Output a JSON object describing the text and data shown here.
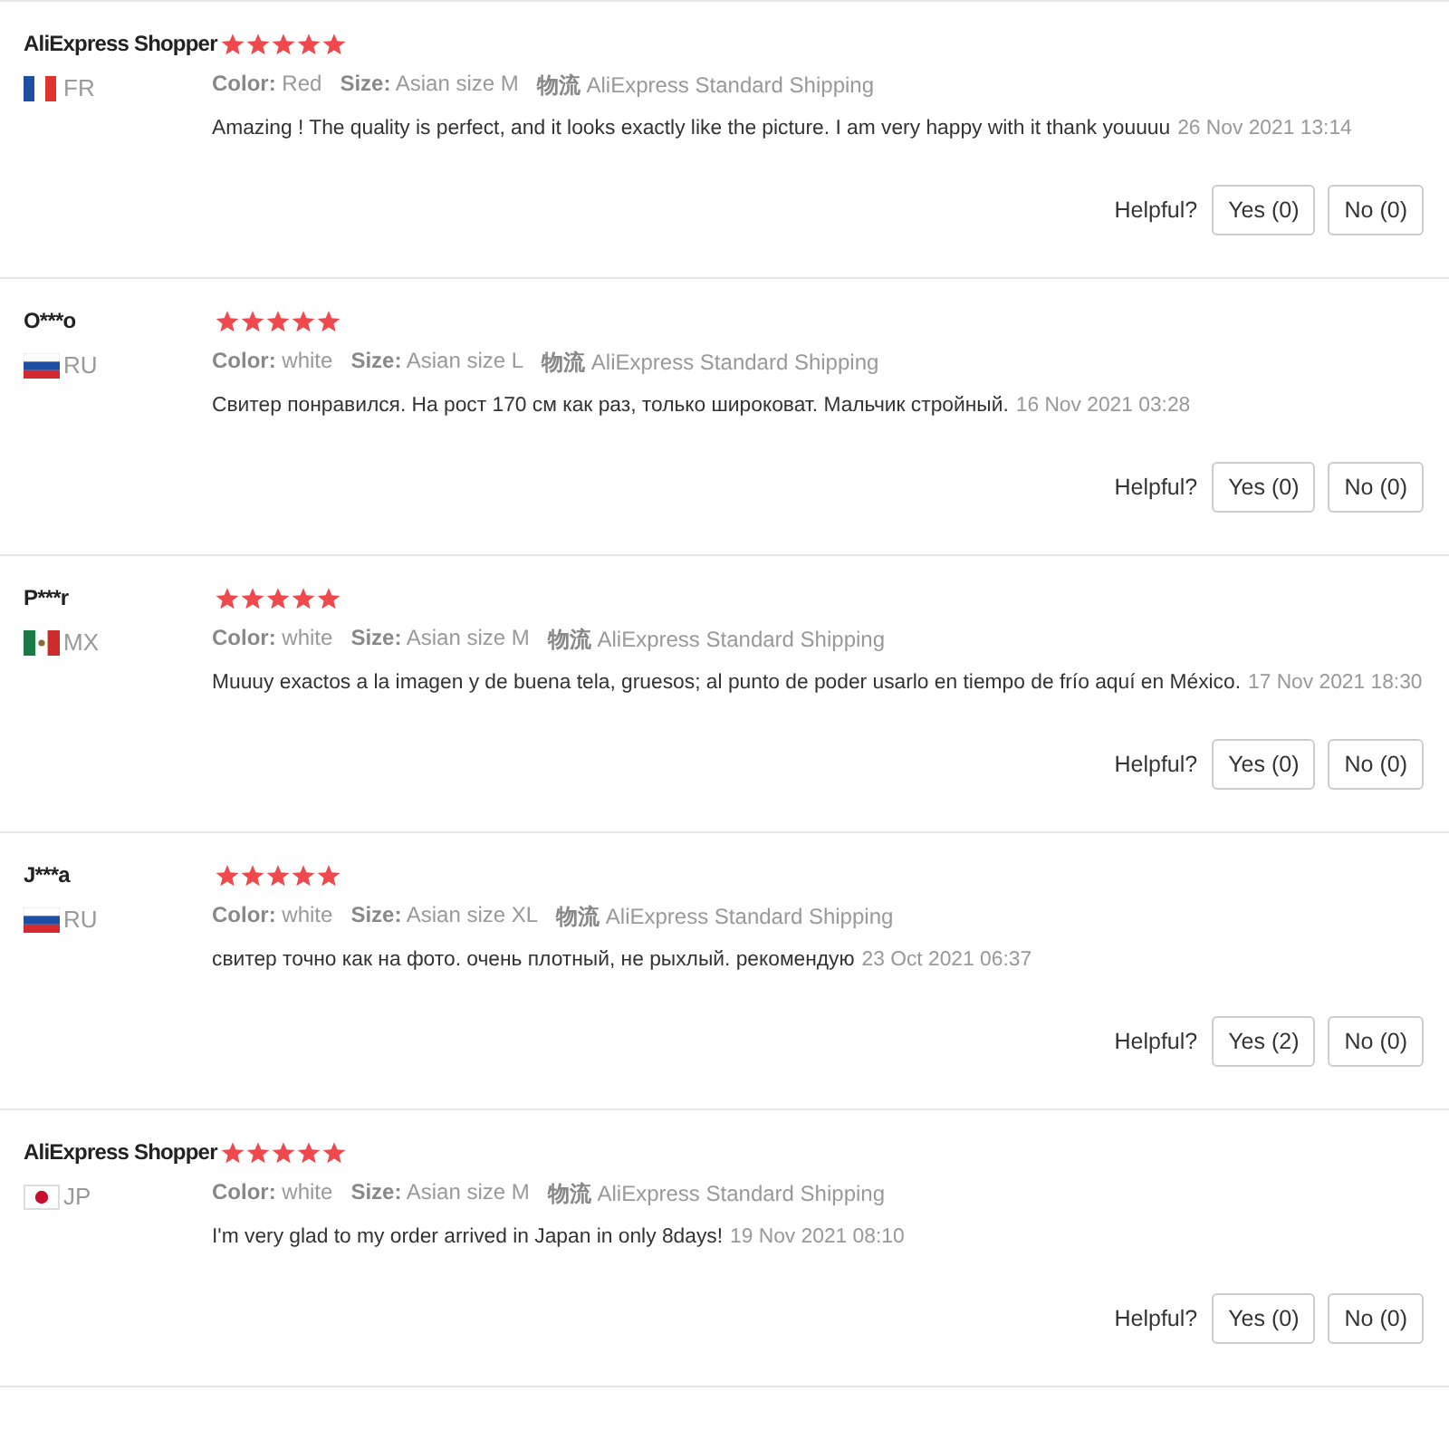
{
  "reviews": [
    {
      "name": "AliExpress Shopper",
      "stars": 5,
      "kind": "france",
      "country": "FR",
      "meta": [
        {
          "label": "Color:",
          "value": "Red"
        },
        {
          "label": "Size:",
          "value": "Asian size M"
        },
        {
          "label": "物流",
          "value": "AliExpress Standard Shipping"
        }
      ],
      "comment": "Amazing ! The quality is perfect, and it looks exactly like the picture. I am very happy with it thank youuuu",
      "date": "26 Nov 2021 13:14",
      "helpful": "Helpful?",
      "yes": "Yes (0)",
      "no": "No (0)"
    },
    {
      "name": "O***o",
      "stars": 5,
      "kind": "russia",
      "country": "RU",
      "meta": [
        {
          "label": "Color:",
          "value": "white"
        },
        {
          "label": "Size:",
          "value": "Asian size L"
        },
        {
          "label": "物流",
          "value": "AliExpress Standard Shipping"
        }
      ],
      "comment": "Свитер понравился. На рост 170 см как раз, только широковат. Мальчик стройный.",
      "date": "16 Nov 2021 03:28",
      "helpful": "Helpful?",
      "yes": "Yes (0)",
      "no": "No (0)"
    },
    {
      "name": "P***r",
      "stars": 5,
      "kind": "mexico",
      "country": "MX",
      "meta": [
        {
          "label": "Color:",
          "value": "white"
        },
        {
          "label": "Size:",
          "value": "Asian size M"
        },
        {
          "label": "物流",
          "value": "AliExpress Standard Shipping"
        }
      ],
      "comment": "Muuuy exactos a la imagen y de buena tela, gruesos; al punto de poder usarlo en tiempo de frío aquí en México.",
      "date": "17 Nov 2021 18:30",
      "helpful": "Helpful?",
      "yes": "Yes (0)",
      "no": "No (0)"
    },
    {
      "name": "J***a",
      "stars": 5,
      "kind": "russia",
      "country": "RU",
      "meta": [
        {
          "label": "Color:",
          "value": "white"
        },
        {
          "label": "Size:",
          "value": "Asian size XL"
        },
        {
          "label": "物流",
          "value": "AliExpress Standard Shipping"
        }
      ],
      "comment": "свитер точно как на фото. очень плотный, не рыхлый. рекомендую",
      "date": "23 Oct 2021 06:37",
      "helpful": "Helpful?",
      "yes": "Yes (2)",
      "no": "No (0)"
    },
    {
      "name": "AliExpress Shopper",
      "stars": 5,
      "kind": "japan",
      "country": "JP",
      "meta": [
        {
          "label": "Color:",
          "value": "white"
        },
        {
          "label": "Size:",
          "value": "Asian size M"
        },
        {
          "label": "物流",
          "value": "AliExpress Standard Shipping"
        }
      ],
      "comment": "I'm very glad to my order arrived in Japan in only 8days!",
      "date": "19 Nov 2021 08:10",
      "helpful": "Helpful?",
      "yes": "Yes (0)",
      "no": "No (0)"
    }
  ]
}
